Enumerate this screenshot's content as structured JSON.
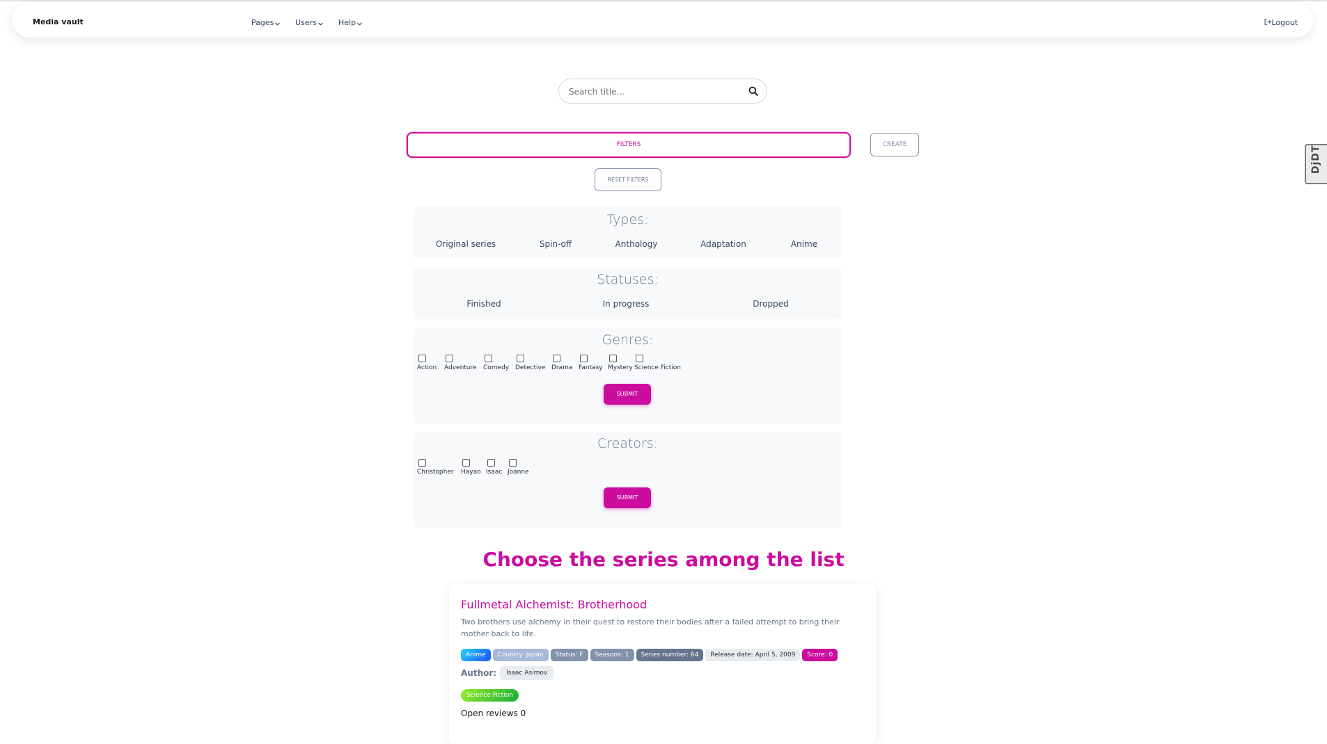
{
  "navbar": {
    "brand": "Media vault",
    "items": [
      {
        "label": "Pages"
      },
      {
        "label": "Users"
      },
      {
        "label": "Help"
      }
    ],
    "logout": "Logout"
  },
  "debug_toolbar": {
    "label": "DjDT"
  },
  "search": {
    "placeholder": "Search title..."
  },
  "controls": {
    "filters": "FILTERS",
    "create": "CREATE",
    "reset": "RESET FILTERS"
  },
  "types": {
    "title": "Types:",
    "options": [
      "Original series",
      "Spin-off",
      "Anthology",
      "Adaptation",
      "Anime"
    ]
  },
  "statuses": {
    "title": "Statuses:",
    "options": [
      "Finished",
      "In progress",
      "Dropped"
    ]
  },
  "genres": {
    "title": "Genres:",
    "options": [
      "Action",
      "Adventure",
      "Comedy",
      "Detective",
      "Drama",
      "Fantasy",
      "Mystery",
      "Science Fiction"
    ],
    "submit": "SUBMIT"
  },
  "creators": {
    "title": "Creators:",
    "options": [
      "Christopher",
      "Hayao",
      "Isaac",
      "Joanne"
    ],
    "submit": "SUBMIT"
  },
  "list": {
    "heading": "Choose the series among the list",
    "series": [
      {
        "title": "Fullmetal Alchemist: Brotherhood",
        "description": "Two brothers use alchemy in their quest to restore their bodies after a failed attempt to bring their mother back to life.",
        "badges": {
          "type": "Anime",
          "country": "Country: Japan",
          "status": "Status: F",
          "seasons": "Seasons: 1",
          "series_number": "Series number: 64",
          "release_date": "Release date: April 5, 2009",
          "score": "Score: 0"
        },
        "author_label": "Author:",
        "author": "Isaac Asimov",
        "genre": "Science Fiction",
        "reviews": "Open reviews 0"
      }
    ]
  },
  "colors": {
    "accent": "#cb0c9f",
    "secondary": "#8392ab",
    "text": "#344767"
  }
}
